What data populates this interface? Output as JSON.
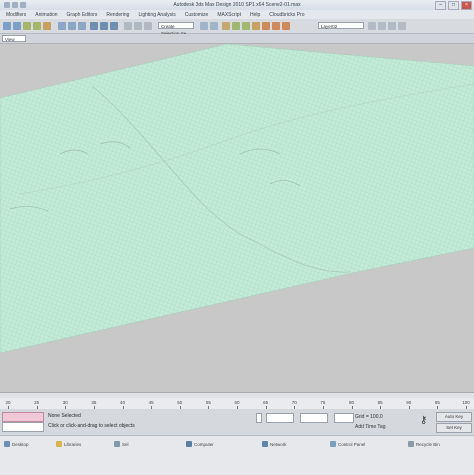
{
  "window": {
    "title": "Autodesk 3ds Max Design 2010 SP1 x64    Scene2-01.max"
  },
  "menu": [
    "Modifiers",
    "Animation",
    "Graph Editors",
    "Rendering",
    "Lighting Analysis",
    "Customize",
    "MAXScript",
    "Help",
    "Cloudbricks Pro"
  ],
  "toolbar": {
    "view_dropdown": "View",
    "selection_set": "Create Selection Se",
    "layer_dropdown": "Layer02"
  },
  "timeline": {
    "ticks": [
      "20",
      "25",
      "30",
      "35",
      "40",
      "45",
      "50",
      "55",
      "60",
      "65",
      "70",
      "75",
      "80",
      "85",
      "90",
      "95",
      "100"
    ]
  },
  "status": {
    "selection": "None Selected",
    "prompt": "Click or click-and-drag to select objects",
    "grid": "Grid = 100.0",
    "add_time_tag": "Add Time Tag",
    "auto_key": "Auto Key",
    "set_key": "Set Key"
  },
  "taskbar": [
    {
      "label": "Desktop",
      "icon": "desktop-icon",
      "color": "#6d8fb5"
    },
    {
      "label": "Libraries",
      "icon": "folder-icon",
      "color": "#d9b350"
    },
    {
      "label": "Sel",
      "icon": "user-icon",
      "color": "#7f9aa8"
    },
    {
      "label": "Computer",
      "icon": "computer-icon",
      "color": "#5b7ea6"
    },
    {
      "label": "Network",
      "icon": "network-icon",
      "color": "#5f86a8"
    },
    {
      "label": "Control Panel",
      "icon": "control-panel-icon",
      "color": "#7aa0c0"
    },
    {
      "label": "Recycle Bin",
      "icon": "recycle-bin-icon",
      "color": "#8c9aa5"
    }
  ],
  "colors": {
    "mesh": "#c3ecd8",
    "viewport_bg": "#c8c8c8"
  }
}
